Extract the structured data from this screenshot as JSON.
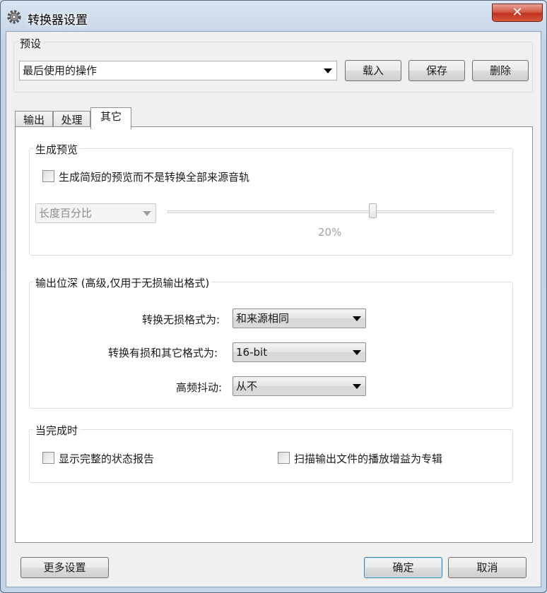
{
  "window": {
    "title": "转换器设置",
    "close_glyph": "✕"
  },
  "preset": {
    "group_label": "预设",
    "selected": "最后使用的操作",
    "load_label": "载入",
    "save_label": "保存",
    "delete_label": "删除"
  },
  "tabs": [
    {
      "label": "输出"
    },
    {
      "label": "处理"
    },
    {
      "label": "其它",
      "active": true
    }
  ],
  "preview": {
    "group_label": "生成预览",
    "checkbox_label": "生成简短的预览而不是转换全部来源音轨",
    "checked": false,
    "mode_selected": "长度百分比",
    "slider_value_text": "20%",
    "slider_fraction": 0.63
  },
  "bitdepth": {
    "group_label": "输出位深 (高级,仅用于无损输出格式)",
    "lossless_label": "转换无损格式为:",
    "lossless_value": "和来源相同",
    "lossy_label": "转换有损和其它格式为:",
    "lossy_value": "16-bit",
    "dither_label": "高频抖动:",
    "dither_value": "从不"
  },
  "on_complete": {
    "group_label": "当完成时",
    "status_report_label": "显示完整的状态报告",
    "status_report_checked": false,
    "replaygain_label": "扫描输出文件的播放增益为专辑",
    "replaygain_checked": false
  },
  "footer": {
    "more_settings_label": "更多设置",
    "ok_label": "确定",
    "cancel_label": "取消"
  },
  "icons": {
    "window": "gear-icon",
    "dropdown": "chevron-down-icon"
  }
}
